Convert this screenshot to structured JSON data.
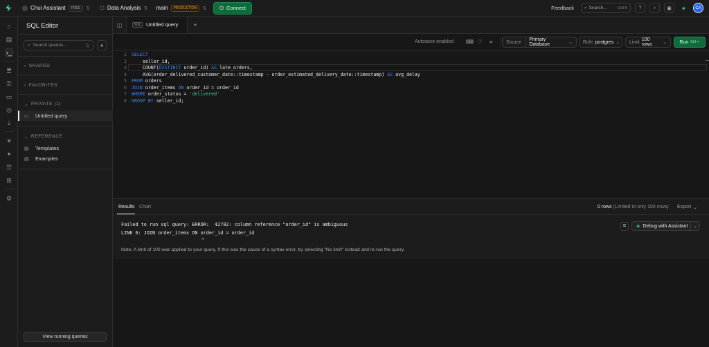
{
  "topbar": {
    "org": "Chui Assistant",
    "org_badge": "FREE",
    "project": "Data Analysis",
    "branch": "main",
    "branch_badge": "PRODUCTION",
    "connect_label": "Connect",
    "feedback": "Feedback",
    "search_label": "Search...",
    "search_shortcut": "Ctrl K",
    "avatar_initials": "CA"
  },
  "sidebar": {
    "title": "SQL Editor",
    "search_placeholder": "Search queries...",
    "sections": {
      "shared": "SHARED",
      "favorites": "FAVORITES",
      "private": "PRIVATE (1)",
      "reference": "REFERENCE"
    },
    "private_items": [
      "Untitled query"
    ],
    "reference_items": [
      "Templates",
      "Examples"
    ],
    "view_running": "View running queries"
  },
  "tabs": {
    "active": "Untitled query"
  },
  "toolbar": {
    "autosave": "Autosave enabled",
    "source_label": "Source",
    "source_value": "Primary Database",
    "role_label": "Role",
    "role_value": "postgres",
    "limit_label": "Limit",
    "limit_value": "100 rows",
    "run_label": "Run",
    "run_shortcut": "Ctrl ↵"
  },
  "editor": {
    "line_numbers": [
      "1",
      "2",
      "3",
      "4",
      "5",
      "6",
      "7",
      "8"
    ]
  },
  "results": {
    "tab_results": "Results",
    "tab_chart": "Chart",
    "rows_count": "0 rows",
    "rows_note": "(Limited to only 100 rows)",
    "export": "Export",
    "error_line1": "Failed to run sql query: ERROR:  42702: column reference \"order_id\" is ambiguous",
    "error_line2": "LINE 6: JOIN order_items ON order_id = order_id",
    "error_caret": "^",
    "note": "Note: A limit of 100 was applied to your query. If this was the cause of a syntax error, try selecting \"No limit\" instead and re-run the query.",
    "debug_label": "Debug with Assistant"
  },
  "colors": {
    "accent": "#3ecf8e",
    "keyword": "#3b82f6",
    "production": "#e0a13c"
  }
}
